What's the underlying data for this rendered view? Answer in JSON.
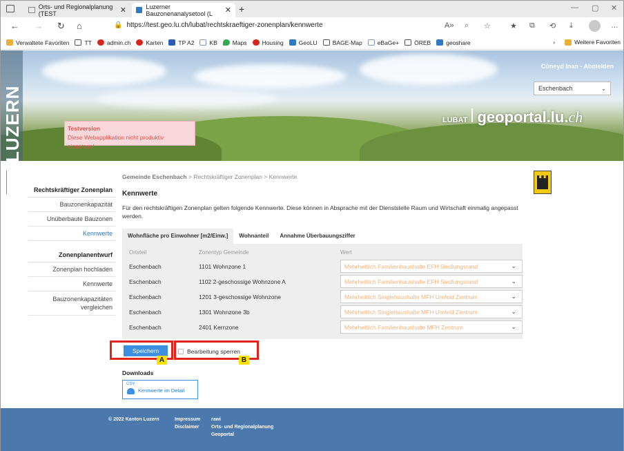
{
  "browser": {
    "tabs": [
      {
        "label": "Orts- und Regionalplanung (TEST"
      },
      {
        "label": "Luzerner Bauzonenanalysetool (L"
      }
    ],
    "url": "https://test.geo.lu.ch/lubat/rechtskraeftiger-zonenplan/kennwerte",
    "favorites": [
      "Verwaltete Favoriten",
      "TT",
      "admin.ch",
      "Karten",
      "TP A2",
      "KB",
      "Maps",
      "Housing",
      "GeoLU",
      "BAGE-Map",
      "eBaGe+",
      "ÖREB",
      "geoshare"
    ],
    "more_favorites": "Weitere Favoriten"
  },
  "banner": {
    "side_text": "LUZERN",
    "user": "Cüneyd Inan - Abmelden",
    "gemeinde_select": "Eschenbach",
    "brand_lubat": "LUBAT",
    "brand_geo": "geoportal.lu.",
    "brand_ch": "ch",
    "test_title": "Testversion",
    "test_text": "Diese Webapplikation nicht produktiv einsetzen!"
  },
  "sidebar": {
    "group1": "Rechtskräftiger Zonenplan",
    "items1": [
      "Bauzonenkapazität",
      "Unüberbaute Bauzonen",
      "Kennwerte"
    ],
    "group2": "Zonenplanentwurf",
    "items2": [
      "Zonenplan hochladen",
      "Kennwerte",
      "Bauzonenkapazitäten vergleichen"
    ]
  },
  "main": {
    "breadcrumb_gemeinde": "Gemeinde Eschenbach",
    "breadcrumb_rest": " > Rechtskräftiger Zonenplan > Kennwerte",
    "title": "Kennwerte",
    "description": "Für den rechtskräftigen Zonenplan gelten folgende Kennwerte. Diese können in Absprache mit der Dienststelle Raum und Wirtschaft einmalig angepasst werden.",
    "tabs": [
      "Wohnfläche pro Einwohner [m2/Einw.]",
      "Wohnanteil",
      "Annahme Überbauungsziffer"
    ],
    "columns": [
      "Ortsteil",
      "Zonentyp Gemeinde",
      "Wert"
    ],
    "rows": [
      {
        "ortsteil": "Eschenbach",
        "zonentyp": "1101 Wohnzone 1",
        "wert": "Mehrheitlich Familienhaushalte EFH Siedlungsrand"
      },
      {
        "ortsteil": "Eschenbach",
        "zonentyp": "1102 2-geschossige Wohnzone A",
        "wert": "Mehrheitlich Familienhaushalte EFH Siedlungsrand"
      },
      {
        "ortsteil": "Eschenbach",
        "zonentyp": "1201 3-geschossige Wohnzone",
        "wert": "Mehrheitlich Singlehaushalte MFH Umfeld Zentrum"
      },
      {
        "ortsteil": "Eschenbach",
        "zonentyp": "1301 Wohnzone 3b",
        "wert": "Mehrheitlich Singlehaushalte MFH Umfeld Zentrum"
      },
      {
        "ortsteil": "Eschenbach",
        "zonentyp": "2401 Kernzone",
        "wert": "Mehrheitlich Familienhaushalte MFH Zentrum"
      }
    ],
    "save_label": "Speichern",
    "lock_label": "Bearbeitung sperren",
    "marker_a": "A",
    "marker_b": "B",
    "downloads_title": "Downloads",
    "download_csv": "CSV",
    "download_label": "Kennwerte im Detail"
  },
  "footer": {
    "copyright": "© 2022 Kanton Luzern",
    "impressum": "Impressum",
    "disclaimer": "Disclaimer",
    "rawi": "rawi",
    "orp": "Orts- und Regionalplanung",
    "geoportal": "Geoportal"
  },
  "colors": {
    "accent": "#3d8fe2",
    "footer": "#4b78ad",
    "highlight": "#e0241c",
    "marker": "#ffe100",
    "value_text": "#f0b27a"
  }
}
